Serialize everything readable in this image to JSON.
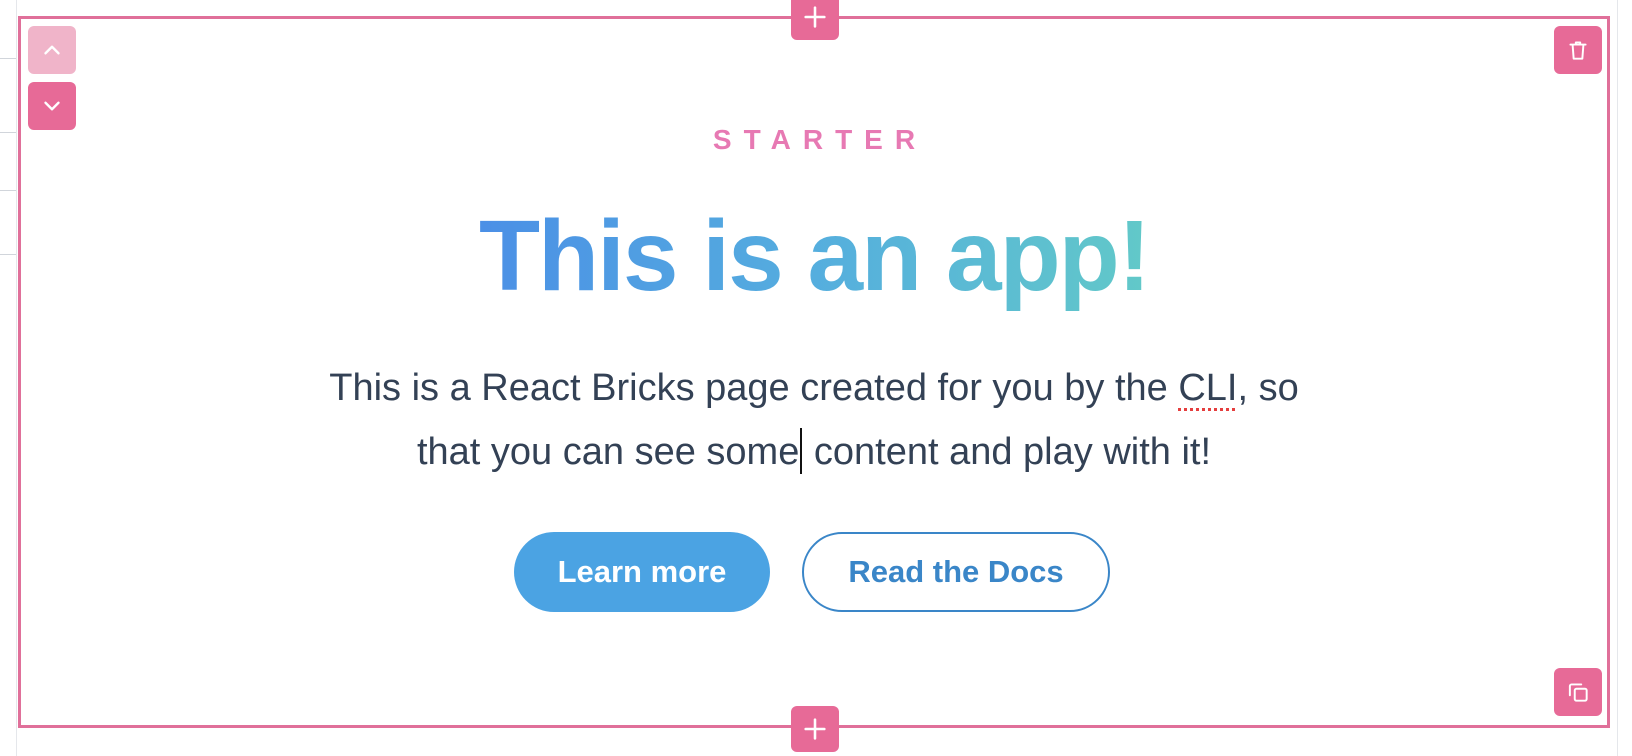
{
  "hero": {
    "eyebrow": "STARTER",
    "headline": "This is an app!",
    "body_part1": "This is a React Bricks page created for you by the ",
    "body_spell": "CLI",
    "body_part2": ", so that you can see some",
    "body_part3": " content and play with it!",
    "primary_button": "Learn more",
    "secondary_button": "Read the Docs"
  },
  "controls": {
    "move_up": "chevron-up-icon",
    "move_down": "chevron-down-icon",
    "delete": "trash-icon",
    "duplicate": "duplicate-icon",
    "add_above": "plus-icon",
    "add_below": "plus-icon"
  },
  "colors": {
    "frame": "#e0709a",
    "control_bg": "#e76a97",
    "control_disabled_bg": "#f0b4c9",
    "eyebrow": "#e779b3",
    "headline_gradient_start": "#4b8fe6",
    "headline_gradient_end": "#62c9c8",
    "primary_button": "#4ba3e3",
    "secondary_button_border": "#3a86c8",
    "body_text": "#334155"
  }
}
